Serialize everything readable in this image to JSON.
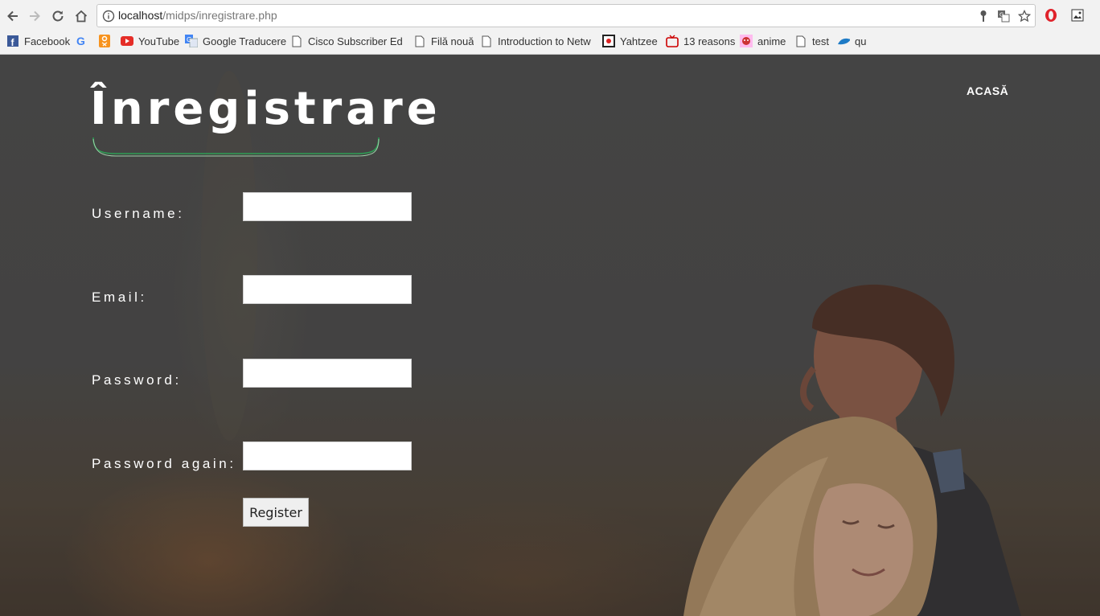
{
  "browser": {
    "url_host": "localhost",
    "url_path": "/midps/inregistrare.php",
    "bookmarks": [
      {
        "label": "Facebook",
        "icon": "facebook-icon"
      },
      {
        "label": "",
        "icon": "google-icon"
      },
      {
        "label": "",
        "icon": "odnoklassniki-icon"
      },
      {
        "label": "YouTube",
        "icon": "youtube-icon"
      },
      {
        "label": "Google Traducere",
        "icon": "google-translate-icon"
      },
      {
        "label": "Cisco Subscriber Edge",
        "icon": "page-icon"
      },
      {
        "label": "Filă nouă",
        "icon": "page-icon"
      },
      {
        "label": "Introduction to Netw",
        "icon": "page-icon"
      },
      {
        "label": "Yahtzee",
        "icon": "yahtzee-icon"
      },
      {
        "label": "13 reasons",
        "icon": "tv-icon"
      },
      {
        "label": "anime",
        "icon": "anime-icon"
      },
      {
        "label": "test",
        "icon": "page-icon"
      },
      {
        "label": "qu",
        "icon": "wave-icon"
      }
    ]
  },
  "page": {
    "title": "Înregistrare",
    "nav_home": "ACASĂ",
    "accent_color": "#2e9e55",
    "form": {
      "username_label": "Username:",
      "email_label": "Email:",
      "password_label": "Password:",
      "password_again_label": "Password again:",
      "username_value": "",
      "email_value": "",
      "password_value": "",
      "password_again_value": "",
      "register_label": "Register"
    }
  }
}
